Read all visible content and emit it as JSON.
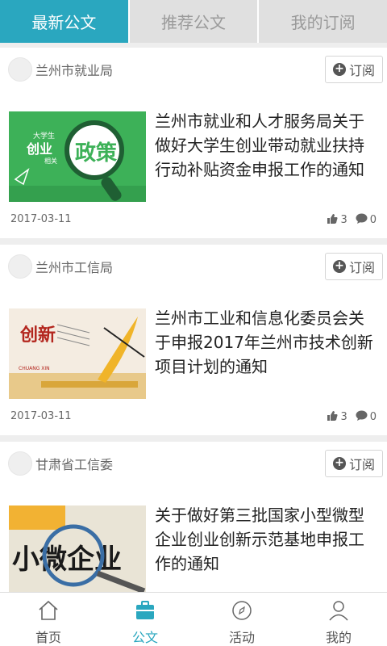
{
  "tabs": [
    {
      "label": "最新公文",
      "active": true
    },
    {
      "label": "推荐公文",
      "active": false
    },
    {
      "label": "我的订阅",
      "active": false
    }
  ],
  "subscribe_label": "订阅",
  "articles": [
    {
      "source": "兰州市就业局",
      "title": "兰州市就业和人才服务局关于做好大学生创业带动就业扶持行动补贴资金申报工作的通知",
      "date": "2017-03-11",
      "likes": "3",
      "comments": "0",
      "thumb_text": {
        "small1": "大学生",
        "big": "创业",
        "small2": "相关",
        "main": "政策"
      }
    },
    {
      "source": "兰州市工信局",
      "title": "兰州市工业和信息化委员会关于申报2017年兰州市技术创新项目计划的通知",
      "date": "2017-03-11",
      "likes": "3",
      "comments": "0",
      "thumb_text": {
        "big": "创新",
        "small": "CHUANG XIN"
      }
    },
    {
      "source": "甘肃省工信委",
      "title": "关于做好第三批国家小型微型企业创业创新示范基地申报工作的通知",
      "thumb_text": {
        "main": "小微企业"
      }
    }
  ],
  "nav": [
    {
      "label": "首页",
      "icon": "home-icon",
      "active": false
    },
    {
      "label": "公文",
      "icon": "briefcase-icon",
      "active": true
    },
    {
      "label": "活动",
      "icon": "compass-icon",
      "active": false
    },
    {
      "label": "我的",
      "icon": "person-icon",
      "active": false
    }
  ],
  "colors": {
    "accent": "#2aa7bf",
    "tab_inactive": "#e0e0e0",
    "policy_green": "#3db158"
  }
}
